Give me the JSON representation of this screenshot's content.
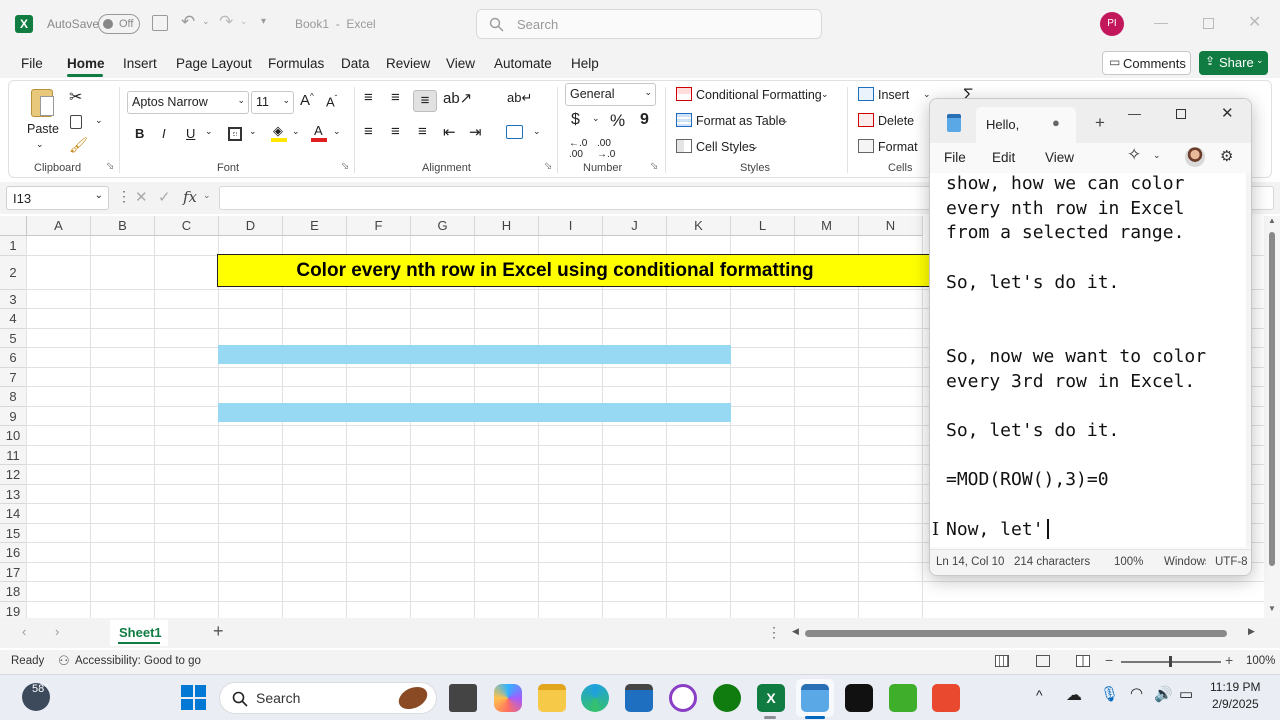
{
  "titlebar": {
    "autosave_label": "AutoSave",
    "autosave_state": "Off",
    "doc_title": "Book1  -  Excel",
    "search_placeholder": "Search",
    "avatar_initials": "PI"
  },
  "menu": {
    "items": [
      "File",
      "Home",
      "Insert",
      "Page Layout",
      "Formulas",
      "Data",
      "Review",
      "View",
      "Automate",
      "Help"
    ],
    "active": "Home",
    "comments_label": "Comments",
    "share_label": "Share"
  },
  "ribbon": {
    "clipboard": {
      "paste_label": "Paste",
      "group_label": "Clipboard"
    },
    "font": {
      "name": "Aptos Narrow",
      "size": "11",
      "group_label": "Font"
    },
    "alignment": {
      "group_label": "Alignment"
    },
    "number": {
      "format": "General",
      "currency_symbol": "$",
      "percent_symbol": "%",
      "comma_symbol": "9",
      "group_label": "Number"
    },
    "styles": {
      "conditional_formatting": "Conditional Formatting",
      "format_as_table": "Format as Table",
      "cell_styles": "Cell Styles",
      "group_label": "Styles"
    },
    "cells": {
      "insert": "Insert",
      "delete": "Delete",
      "format": "Format",
      "group_label": "Cells"
    },
    "editing_sigma": "Σ"
  },
  "formula_bar": {
    "name_box": "I13",
    "fx": "fx",
    "formula": ""
  },
  "grid": {
    "columns": [
      "A",
      "B",
      "C",
      "D",
      "E",
      "F",
      "G",
      "H",
      "I",
      "J",
      "K",
      "L",
      "M",
      "N"
    ],
    "rows": [
      "1",
      "2",
      "3",
      "4",
      "5",
      "6",
      "7",
      "8",
      "9",
      "10",
      "11",
      "12",
      "13",
      "14",
      "15",
      "16",
      "17",
      "18",
      "19"
    ],
    "title_cell": "Color every nth row in Excel using conditional formatting",
    "title_fill": "#ffff00",
    "highlight_fill": "#97d9f3"
  },
  "sheets": {
    "tabs": [
      "Sheet1"
    ],
    "active": "Sheet1"
  },
  "status": {
    "ready": "Ready",
    "accessibility": "Accessibility: Good to go",
    "zoom": "100%"
  },
  "notepad": {
    "tab_title": "Hello,",
    "menu": [
      "File",
      "Edit",
      "View"
    ],
    "lines": [
      "show, how we can color",
      "every nth row in Excel",
      "from a selected range.",
      "",
      "So, let's do it.",
      "",
      "",
      "So, now we want to color",
      "every 3rd row in Excel.",
      "",
      "So, let's do it.",
      "",
      "=MOD(ROW(),3)=0",
      "",
      "Now, let'"
    ],
    "status": {
      "position": "Ln 14, Col 10",
      "characters": "214 characters",
      "zoom": "100%",
      "line_ending": "Windows (CRLF)",
      "encoding": "UTF-8"
    }
  },
  "taskbar": {
    "weather_temp": "58°",
    "search_placeholder": "Search",
    "time": "11:19 PM",
    "date": "2/9/2025"
  }
}
